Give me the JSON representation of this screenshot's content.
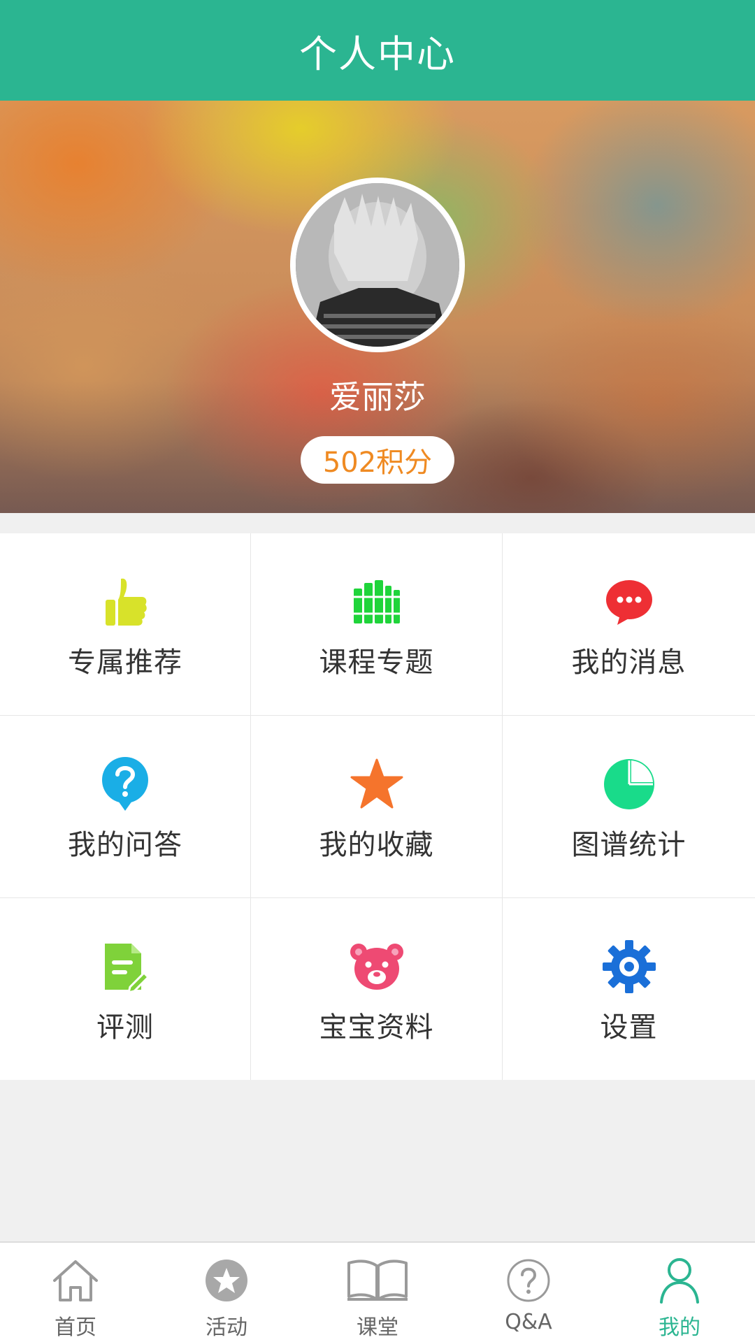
{
  "colors": {
    "accent": "#2bb591",
    "points_text": "#ef8a22"
  },
  "header": {
    "title": "个人中心"
  },
  "profile": {
    "username": "爱丽莎",
    "points_label": "502积分"
  },
  "menu": [
    {
      "label": "专属推荐",
      "icon": "thumbs-up-icon",
      "color": "#d8e22a"
    },
    {
      "label": "课程专题",
      "icon": "books-icon",
      "color": "#1fd43a"
    },
    {
      "label": "我的消息",
      "icon": "message-bubble-icon",
      "color": "#ee2f34"
    },
    {
      "label": "我的问答",
      "icon": "question-bubble-icon",
      "color": "#1aaee6"
    },
    {
      "label": "我的收藏",
      "icon": "star-icon",
      "color": "#f5742c"
    },
    {
      "label": "图谱统计",
      "icon": "pie-chart-icon",
      "color": "#19db8a"
    },
    {
      "label": "评测",
      "icon": "evaluation-document-icon",
      "color": "#7fd23a"
    },
    {
      "label": "宝宝资料",
      "icon": "teddy-bear-icon",
      "color": "#ee4a73"
    },
    {
      "label": "设置",
      "icon": "gear-icon",
      "color": "#1a6fd8"
    }
  ],
  "tabbar": {
    "items": [
      {
        "label": "首页",
        "icon": "home-icon"
      },
      {
        "label": "活动",
        "icon": "star-circle-icon"
      },
      {
        "label": "课堂",
        "icon": "open-book-icon"
      },
      {
        "label": "Q&A",
        "icon": "question-circle-icon"
      },
      {
        "label": "我的",
        "icon": "person-icon",
        "active": true
      }
    ]
  }
}
